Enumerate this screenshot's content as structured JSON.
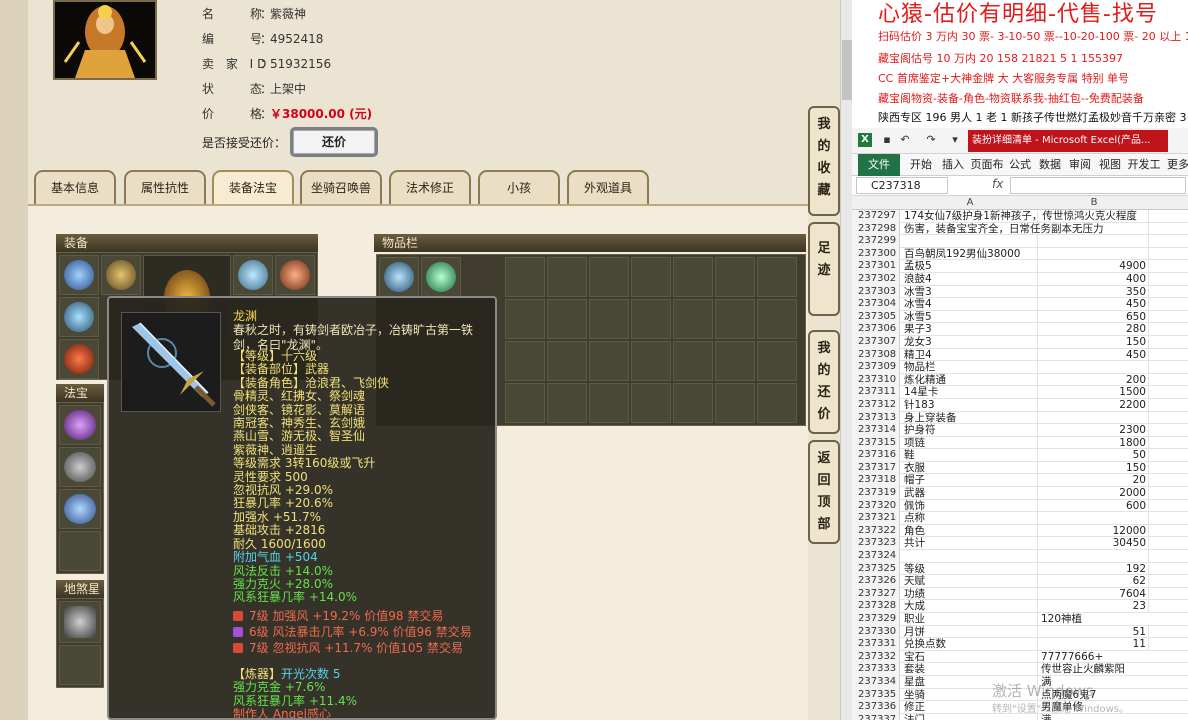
{
  "character": {
    "rows": [
      {
        "label": "名　　称",
        "value": "紫薇神"
      },
      {
        "label": "编　　号",
        "value": "4952418"
      },
      {
        "label": "卖 家 ID",
        "value": "51932156"
      },
      {
        "label": "状　　态",
        "value": "上架中"
      },
      {
        "label": "价　　格",
        "value": "￥38000.00 (元)"
      }
    ],
    "counter_label": "是否接受还价：",
    "counter_button": "还价"
  },
  "tabs": [
    "基本信息",
    "属性抗性",
    "装备法宝",
    "坐骑召唤兽",
    "法术修正",
    "小孩",
    "外观道具"
  ],
  "active_tab": 2,
  "sections": {
    "equip": "装备",
    "items": "物品栏",
    "treasure": "法宝",
    "star": "地煞星"
  },
  "side_buttons": [
    "我的收藏",
    "足迹",
    "我的还价",
    "返回顶部"
  ],
  "tooltip": {
    "name": "龙渊",
    "desc": "春秋之时，有铸剑者欧冶子，冶铸旷古第一铁剑，名曰\"龙渊\"。",
    "lines_yellow": [
      "【等级】十六级",
      "【装备部位】武器",
      "【装备角色】沧浪君、飞剑侠",
      "骨精灵、红拂女、祭剑魂",
      "剑侠客、镜花影、莫解语",
      "南冠客、神秀生、玄剑娥",
      "燕山雪、游无极、智圣仙",
      "紫薇神、逍遥生",
      "等级需求 3转160级或飞升",
      "灵性要求 500",
      "忽视抗风 +29.0%",
      "狂暴几率 +20.6%",
      "加强水 +51.7%",
      "基础攻击 +2816",
      "耐久 1600/1600"
    ],
    "cyan": "附加气血 +504",
    "green": [
      "风法反击 +14.0%",
      "强力克火 +28.0%",
      "风系狂暴几率 +14.0%"
    ],
    "runes": [
      {
        "text": "7级 加强风 +19.2% 价值98 禁交易",
        "color": "#d94a3a"
      },
      {
        "text": "6级 风法暴击几率 +6.9% 价值96 禁交易",
        "color": "#a64fd6"
      },
      {
        "text": "7级 忽视抗风 +11.7% 价值105 禁交易",
        "color": "#d94a3a"
      }
    ],
    "refine_label": "【炼器】",
    "refine_value": "开光次数 5",
    "refine_lines": [
      "强力克金 +7.6%",
      "风系狂暴几率 +11.4%"
    ],
    "maker": "制作人 Angel感心"
  },
  "excel": {
    "banner_title": "心猿-估价有明细-代售-找号",
    "banner_lines": [
      {
        "text": "扫码估价 3 万内 30 票- 3-10-50 票--10-20-100 票- 20 以上 150-",
        "black": false
      },
      {
        "text": "藏宝阁估号 10 万内 20 158 21821 5 1 155397",
        "black": false
      },
      {
        "text": "CC 首席鉴定+大神金牌 大 大客服务专属 特别 单号",
        "black": false
      },
      {
        "text": "藏宝阁物资-装备-角色-物资联系我-抽红包--免费配装备",
        "black": false
      },
      {
        "text": "陕西专区 196 男人 1 老 1 新孩子传世燃灯孟极妙音千万亲密 3",
        "black": true
      }
    ],
    "window_title": "装扮详细清单 - Microsoft Excel(产品...",
    "ribbon_tabs": [
      "文件",
      "开始",
      "插入",
      "页面布",
      "公式",
      "数据",
      "审阅",
      "视图",
      "开发工",
      "更多"
    ],
    "name_box": "C237318",
    "fx": "fx",
    "col_a": "A",
    "col_b": "B",
    "rows": [
      [
        "237297",
        "174女仙7级护身1新神孩子，传世惊鸿火克火程度",
        ""
      ],
      [
        "237298",
        "伤害，装备宝宝齐全，日常任务副本无压力",
        ""
      ],
      [
        "237299",
        "",
        ""
      ],
      [
        "237300",
        "百鸟朝凤192男仙38000",
        ""
      ],
      [
        "237301",
        "孟极5",
        "4900"
      ],
      [
        "237302",
        "浪鼓4",
        "400"
      ],
      [
        "237303",
        "冰雪3",
        "350"
      ],
      [
        "237304",
        "冰雪4",
        "450"
      ],
      [
        "237305",
        "冰雪5",
        "650"
      ],
      [
        "237306",
        "果子3",
        "280"
      ],
      [
        "237307",
        "龙女3",
        "150"
      ],
      [
        "237308",
        "精卫4",
        "450"
      ],
      [
        "237309",
        "物品栏",
        ""
      ],
      [
        "237310",
        "炼化精通",
        "200"
      ],
      [
        "237311",
        "14星卡",
        "1500"
      ],
      [
        "237312",
        "针183",
        "2200"
      ],
      [
        "237313",
        "身上穿装备",
        ""
      ],
      [
        "237314",
        "护身符",
        "2300"
      ],
      [
        "237315",
        "项链",
        "1800"
      ],
      [
        "237316",
        "鞋",
        "50"
      ],
      [
        "237317",
        "衣服",
        "150"
      ],
      [
        "237318",
        "帽子",
        "20"
      ],
      [
        "237319",
        "武器",
        "2000"
      ],
      [
        "237320",
        "佩饰",
        "600"
      ],
      [
        "237321",
        "点称",
        ""
      ],
      [
        "237322",
        "角色",
        "12000"
      ],
      [
        "237323",
        "共计",
        "30450"
      ],
      [
        "237324",
        "",
        ""
      ],
      [
        "237325",
        "等级",
        "192"
      ],
      [
        "237326",
        "天赋",
        "62"
      ],
      [
        "237327",
        "功绩",
        "7604"
      ],
      [
        "237328",
        "大成",
        "23"
      ],
      [
        "237329",
        "职业",
        "L:120神植"
      ],
      [
        "237330",
        "月饼",
        "51"
      ],
      [
        "237331",
        "兑换点数",
        "11"
      ],
      [
        "237332",
        "宝石",
        "L:77777666+"
      ],
      [
        "237333",
        "套装",
        "L:传世容止火麟紫阳"
      ],
      [
        "237334",
        "星盘",
        "L:满"
      ],
      [
        "237335",
        "坐骑",
        "L:点两魔6鬼7"
      ],
      [
        "237336",
        "修正",
        "L:男魔单修"
      ],
      [
        "237337",
        "法门",
        "L:满"
      ]
    ],
    "watermark": "激活 Windows",
    "watermark_sub": "转到\"设置\"以激活 Windows。"
  }
}
